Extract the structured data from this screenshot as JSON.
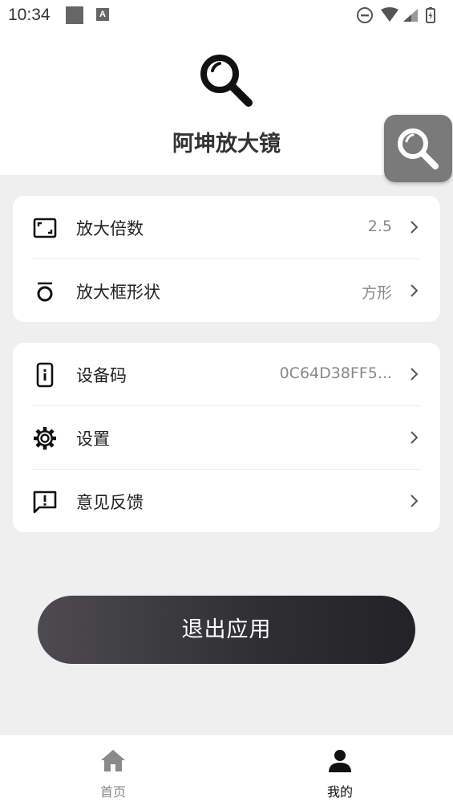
{
  "status_bar": {
    "time": "10:34",
    "notif_icon_b": "A"
  },
  "header": {
    "title": "阿坤放大镜"
  },
  "settings_card": {
    "items": [
      {
        "icon": "zoom-frame-icon",
        "label": "放大倍数",
        "value": "2.5"
      },
      {
        "icon": "shape-icon",
        "label": "放大框形状",
        "value": "方形"
      }
    ]
  },
  "info_card": {
    "items": [
      {
        "icon": "device-icon",
        "label": "设备码",
        "value": "0C64D38FF5..."
      },
      {
        "icon": "gear-icon",
        "label": "设置",
        "value": ""
      },
      {
        "icon": "feedback-icon",
        "label": "意见反馈",
        "value": ""
      }
    ]
  },
  "exit_button": {
    "label": "退出应用"
  },
  "tab_bar": {
    "tabs": [
      {
        "icon": "home-icon",
        "label": "首页",
        "active": false
      },
      {
        "icon": "person-icon",
        "label": "我的",
        "active": true
      }
    ]
  },
  "colors": {
    "accent_dark": "#2f2e33",
    "floating_button": "#7a7a7a",
    "background": "#efefef"
  }
}
